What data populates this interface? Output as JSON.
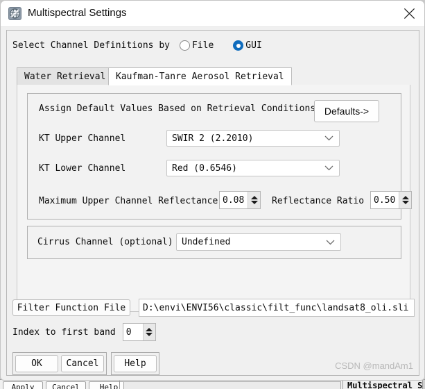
{
  "window": {
    "title": "Multispectral Settings",
    "icon": "satellite-globe-icon",
    "close_label": "×"
  },
  "select_row": {
    "label": "Select Channel Definitions by",
    "options": [
      {
        "label": "File",
        "selected": false
      },
      {
        "label": "GUI",
        "selected": true
      }
    ]
  },
  "tabs": [
    {
      "label": "Water Retrieval",
      "active": false
    },
    {
      "label": "Kaufman-Tanre Aerosol Retrieval",
      "active": true
    }
  ],
  "aerosol_panel": {
    "defaults_label": "Assign Default Values Based on Retrieval Conditions",
    "defaults_button": "Defaults->",
    "upper_channel_label": "KT Upper Channel",
    "upper_channel_value": "SWIR 2 (2.2010)",
    "lower_channel_label": "KT Lower Channel",
    "lower_channel_value": "Red (0.6546)",
    "max_reflectance_label": "Maximum Upper Channel Reflectance",
    "max_reflectance_value": "0.08",
    "reflectance_ratio_label": "Reflectance Ratio",
    "reflectance_ratio_value": "0.50",
    "cirrus_label": "Cirrus Channel (optional)",
    "cirrus_value": "Undefined"
  },
  "filter": {
    "button_label": "Filter Function File",
    "path_value": "D:\\envi\\ENVI56\\classic\\filt_func\\landsat8_oli.sli",
    "index_label": "Index to first band",
    "index_value": "0"
  },
  "buttons": {
    "ok": "OK",
    "cancel": "Cancel",
    "help": "Help"
  },
  "watermark": "CSDN @mandAm1",
  "background_window": {
    "buttons": [
      "Apply",
      "Cancel",
      "Help"
    ],
    "title": "Multispectral Settings"
  },
  "colors": {
    "accent": "#0f6cbd",
    "dialog_bg": "#f0f0f0",
    "titlebar_bg": "#ffffff",
    "field_bg": "#ffffff"
  }
}
